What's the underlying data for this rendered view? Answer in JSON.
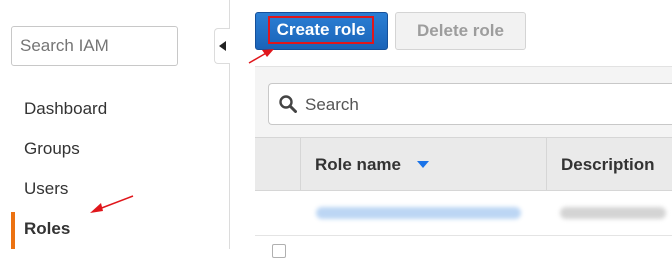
{
  "sidebar": {
    "search_placeholder": "Search IAM",
    "items": [
      {
        "label": "Dashboard"
      },
      {
        "label": "Groups"
      },
      {
        "label": "Users"
      },
      {
        "label": "Roles",
        "active": true
      }
    ],
    "accent_color": "#ec7211"
  },
  "toolbar": {
    "create_label": "Create role",
    "delete_label": "Delete role"
  },
  "search": {
    "placeholder": "Search"
  },
  "table": {
    "columns": [
      {
        "label": "Role name",
        "sorted": "descending"
      },
      {
        "label": "Description"
      }
    ]
  },
  "colors": {
    "primary_button": "#1a63b8",
    "highlight_box": "#e0161b",
    "annotation_arrow": "#e0161b"
  },
  "icons": {
    "collapse": "chevron-left-icon",
    "search": "magnifier-icon",
    "sort": "caret-down-icon"
  }
}
